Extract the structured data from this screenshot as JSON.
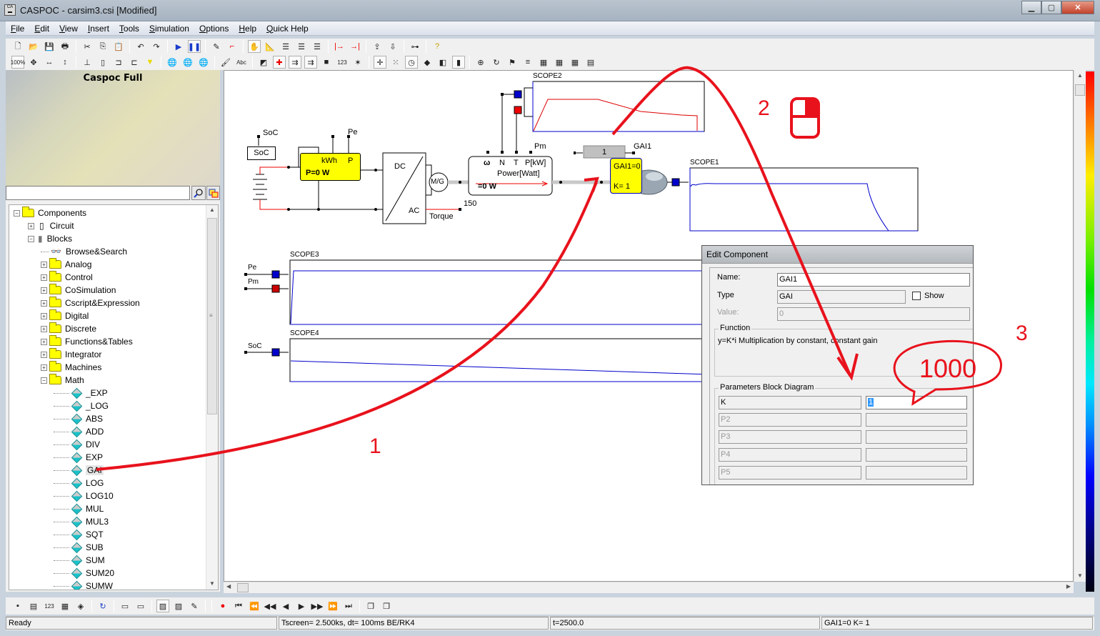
{
  "window": {
    "title": "CASPOC - carsim3.csi [Modified]",
    "icon": "caspoc-app-icon",
    "buttons": [
      "minimize",
      "maximize",
      "close"
    ]
  },
  "menu": [
    {
      "label": "File",
      "accel": "F"
    },
    {
      "label": "Edit",
      "accel": "E"
    },
    {
      "label": "View",
      "accel": "V"
    },
    {
      "label": "Insert",
      "accel": "I"
    },
    {
      "label": "Tools",
      "accel": "T"
    },
    {
      "label": "Simulation",
      "accel": "S"
    },
    {
      "label": "Options",
      "accel": "O"
    },
    {
      "label": "Help",
      "accel": "H"
    },
    {
      "label": "Quick Help",
      "accel": "Q"
    }
  ],
  "toolbar1": [
    "new-icon",
    "open-icon",
    "save-icon",
    "print-icon",
    "|",
    "cut-icon",
    "copy-icon",
    "paste-icon",
    "|",
    "undo-icon",
    "redo-icon",
    "|",
    "run-icon",
    "pause-icon",
    "|",
    "comment-icon",
    "wire-icon",
    "|",
    "hand-icon",
    "draw-icon",
    "list-icon",
    "list2-icon",
    "list3-icon",
    "|",
    "ic-right-icon",
    "ic-left-icon",
    "|",
    "export-icon",
    "import-icon",
    "|",
    "tree-icon",
    "|",
    "help-icon"
  ],
  "toolbar2": [
    "zoom-100-icon",
    "zoom-fit-icon",
    "zoom-width-icon",
    "zoom-height-icon",
    "|",
    "ground-icon",
    "resistor-icon",
    "block-in-icon",
    "block-out-icon",
    "probe-icon",
    "|",
    "globe-icon",
    "globe2-icon",
    "globe3-icon",
    "|",
    "paint-icon",
    "text-icon",
    "|",
    "3d-icon",
    "node-icon",
    "wire-probe-icon",
    "wire-color-icon",
    "block-probe-icon",
    "number-icon",
    "wand-icon",
    "|",
    "crosshair-icon",
    "grid-icon",
    "clock-icon",
    "fill-icon",
    "contrast-icon",
    "bar-icon",
    "|",
    "center-icon",
    "rotate-icon",
    "flag-icon",
    "sort-icon",
    "chip-uc-icon",
    "chip-c-icon",
    "chip-h-icon",
    "table-icon"
  ],
  "toolbar_labels": {
    "zoom100": "100%",
    "text": "Abc",
    "number": "123"
  },
  "left_pane": {
    "banner_title": "Caspoc Full",
    "search": {
      "value": "",
      "placeholder": ""
    },
    "tree": [
      {
        "label": "Components",
        "level": 0,
        "expander": "-",
        "icon": "folder"
      },
      {
        "label": "Circuit",
        "level": 1,
        "expander": "+",
        "icon": "resistor"
      },
      {
        "label": "Blocks",
        "level": 1,
        "expander": "-",
        "icon": "block"
      },
      {
        "label": "Browse&Search",
        "level": 2,
        "expander": "",
        "icon": "binoculars"
      },
      {
        "label": "Analog",
        "level": 2,
        "expander": "+",
        "icon": "folder"
      },
      {
        "label": "Control",
        "level": 2,
        "expander": "+",
        "icon": "folder"
      },
      {
        "label": "CoSimulation",
        "level": 2,
        "expander": "+",
        "icon": "folder"
      },
      {
        "label": "Cscript&Expression",
        "level": 2,
        "expander": "+",
        "icon": "folder"
      },
      {
        "label": "Digital",
        "level": 2,
        "expander": "+",
        "icon": "folder"
      },
      {
        "label": "Discrete",
        "level": 2,
        "expander": "+",
        "icon": "folder"
      },
      {
        "label": "Functions&Tables",
        "level": 2,
        "expander": "+",
        "icon": "folder"
      },
      {
        "label": "Integrator",
        "level": 2,
        "expander": "+",
        "icon": "folder"
      },
      {
        "label": "Machines",
        "level": 2,
        "expander": "+",
        "icon": "folder"
      },
      {
        "label": "Math",
        "level": 2,
        "expander": "-",
        "icon": "folder"
      },
      {
        "label": "_EXP",
        "level": 3,
        "expander": "",
        "icon": "diamond"
      },
      {
        "label": "_LOG",
        "level": 3,
        "expander": "",
        "icon": "diamond"
      },
      {
        "label": "ABS",
        "level": 3,
        "expander": "",
        "icon": "diamond"
      },
      {
        "label": "ADD",
        "level": 3,
        "expander": "",
        "icon": "diamond"
      },
      {
        "label": "DIV",
        "level": 3,
        "expander": "",
        "icon": "diamond"
      },
      {
        "label": "EXP",
        "level": 3,
        "expander": "",
        "icon": "diamond"
      },
      {
        "label": "GAI",
        "level": 3,
        "expander": "",
        "icon": "diamond",
        "selected": true
      },
      {
        "label": "LOG",
        "level": 3,
        "expander": "",
        "icon": "diamond"
      },
      {
        "label": "LOG10",
        "level": 3,
        "expander": "",
        "icon": "diamond"
      },
      {
        "label": "MUL",
        "level": 3,
        "expander": "",
        "icon": "diamond"
      },
      {
        "label": "MUL3",
        "level": 3,
        "expander": "",
        "icon": "diamond"
      },
      {
        "label": "SQT",
        "level": 3,
        "expander": "",
        "icon": "diamond"
      },
      {
        "label": "SUB",
        "level": 3,
        "expander": "",
        "icon": "diamond"
      },
      {
        "label": "SUM",
        "level": 3,
        "expander": "",
        "icon": "diamond"
      },
      {
        "label": "SUM20",
        "level": 3,
        "expander": "",
        "icon": "diamond"
      },
      {
        "label": "SUMW",
        "level": 3,
        "expander": "",
        "icon": "diamond"
      }
    ]
  },
  "schematic": {
    "soc_block": "SoC",
    "soc_label": "SoC",
    "energy_meter": {
      "unit1": "kWh",
      "unit2": "P",
      "value": "P=0 W"
    },
    "pe_label": "Pe",
    "converter": {
      "top": "DC",
      "bottom": "AC"
    },
    "machine": "M/G",
    "torque_label": "Torque",
    "torque_value": "150",
    "power_meter": {
      "ports": [
        "ω",
        "N",
        "T",
        "P[kW]"
      ],
      "title": "Power[Watt]",
      "value": "=0 W"
    },
    "pm_label": "Pm",
    "gain_block": {
      "value": "1",
      "name": "GAI1"
    },
    "gain_display": {
      "line1": "GAI1=0",
      "line2": "K= 1"
    },
    "scopes": [
      {
        "name": "SCOPE2"
      },
      {
        "name": "SCOPE1"
      },
      {
        "name": "SCOPE3",
        "inputs": [
          "Pe",
          "Pm"
        ]
      },
      {
        "name": "SCOPE4",
        "inputs": [
          "SoC"
        ]
      }
    ]
  },
  "annotations": {
    "step1": "1",
    "step2": "2",
    "step3": "3",
    "callout": "1000"
  },
  "dialog": {
    "title": "Edit Component",
    "name_label": "Name:",
    "name_value": "GAI1",
    "type_label": "Type",
    "type_value": "GAI",
    "show_label": "Show",
    "show_checked": false,
    "value_label": "Value:",
    "value_value": "0",
    "function_group": "Function",
    "function_text": "y=K*i Multiplication by constant, constant gain",
    "params_group": "Parameters Block Diagram",
    "params": [
      {
        "name": "K",
        "value": "1"
      },
      {
        "name": "P2",
        "value": ""
      },
      {
        "name": "P3",
        "value": ""
      },
      {
        "name": "P4",
        "value": ""
      },
      {
        "name": "P5",
        "value": ""
      }
    ]
  },
  "bottom_toolbar": [
    "component-icon",
    "document-icon",
    "display-123-icon",
    "layout-icon",
    "chip-icon",
    "|",
    "refresh-icon",
    "|",
    "window-icon",
    "window2-icon",
    "|",
    "scope-icon",
    "new-scope-icon",
    "edit-scope-icon",
    "|",
    "|",
    "record-icon",
    "first-icon",
    "fast-back-icon",
    "back-icon",
    "step-back-icon",
    "play-icon",
    "step-forward-icon",
    "fast-forward-icon",
    "last-icon",
    "|",
    "cascade-icon",
    "tile-icon"
  ],
  "status": {
    "ready": "Ready",
    "tscreen": "Tscreen= 2.500ks, dt= 100ms BE/RK4",
    "time": "t=2500.0",
    "selection": "GAI1=0  K= 1"
  },
  "colors": {
    "annotation_red": "#e8121c",
    "trace_blue": "#0000cc",
    "trace_red": "#dd0000",
    "block_yellow": "#ffff00"
  }
}
